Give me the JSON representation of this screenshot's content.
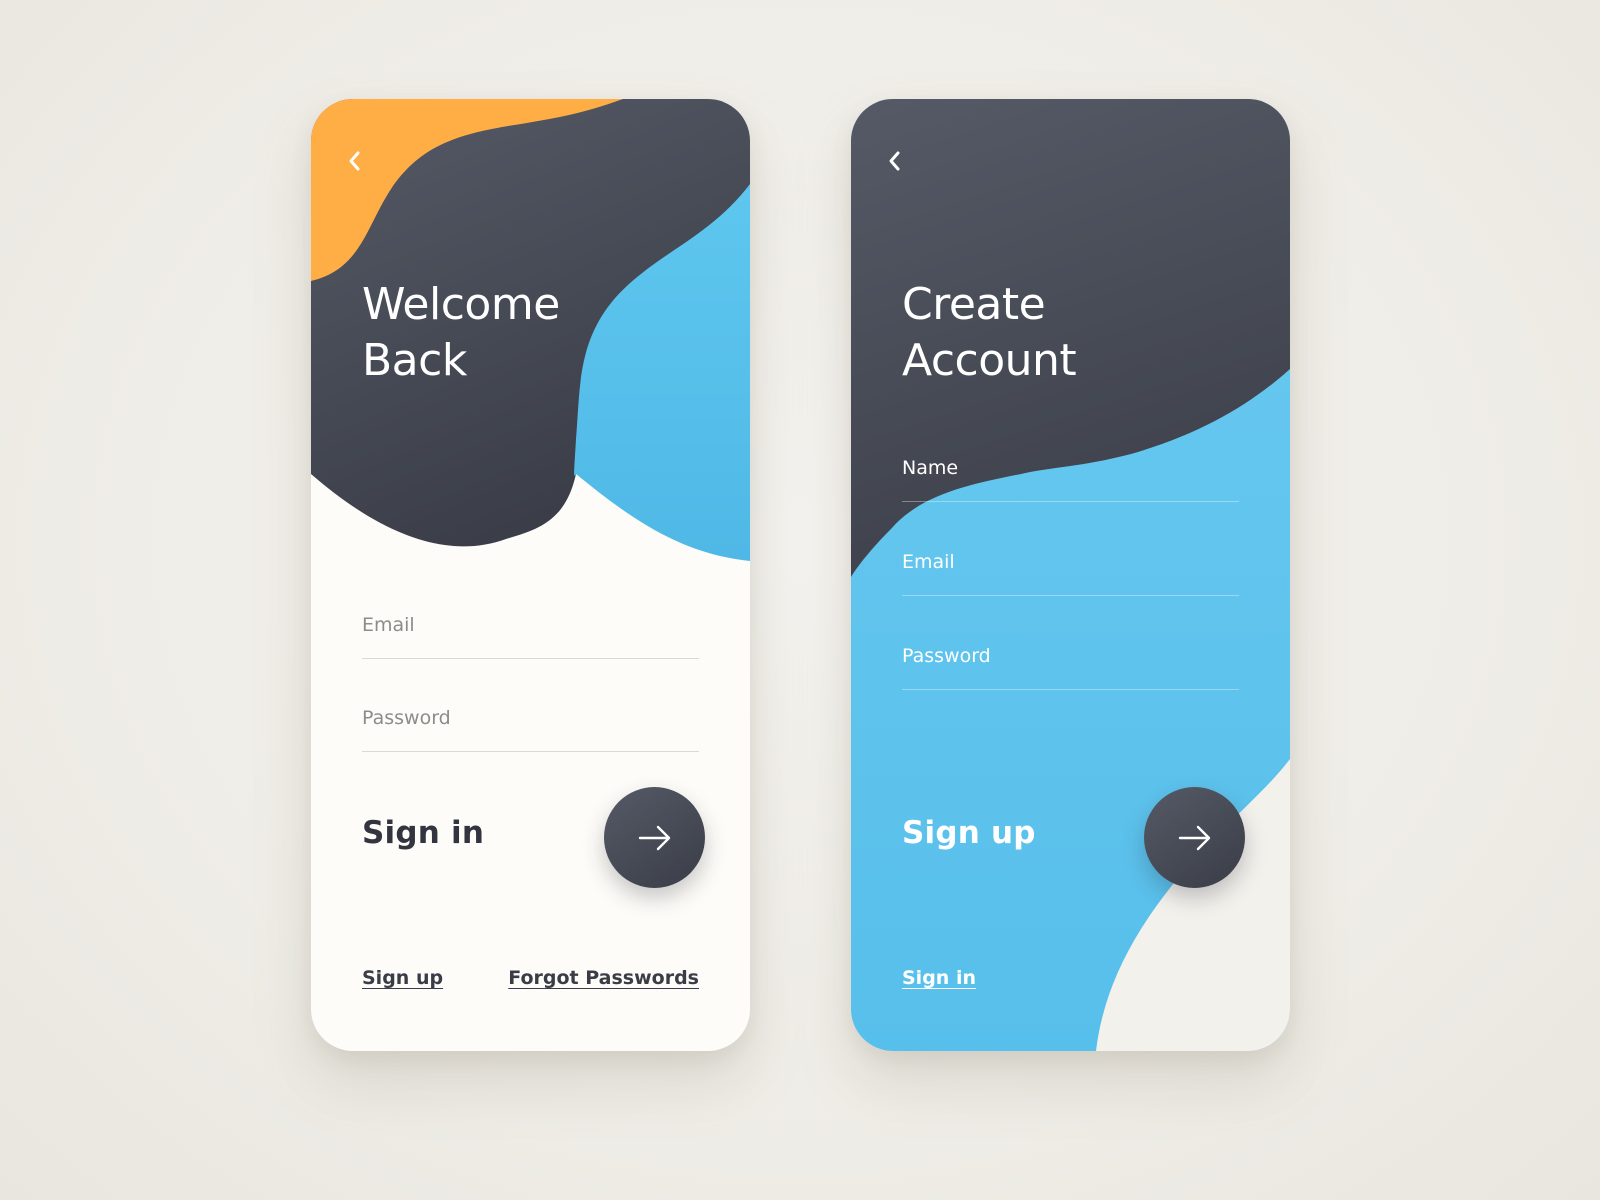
{
  "colors": {
    "page_background": "#efede7",
    "dark": "#464a55",
    "blue": "#5ec3ec",
    "orange": "#ffae46",
    "cream": "#fdfcf8",
    "button": "#474b56"
  },
  "signin_screen": {
    "back_icon": "chevron-left-icon",
    "title_line1": "Welcome",
    "title_line2": "Back",
    "email_label": "Email",
    "password_label": "Password",
    "action_label": "Sign in",
    "submit_icon": "arrow-right-icon",
    "signup_link": "Sign up",
    "forgot_link": "Forgot Passwords"
  },
  "signup_screen": {
    "back_icon": "chevron-left-icon",
    "title_line1": "Create",
    "title_line2": "Account",
    "name_label": "Name",
    "email_label": "Email",
    "password_label": "Password",
    "action_label": "Sign up",
    "submit_icon": "arrow-right-icon",
    "signin_link": "Sign in"
  }
}
